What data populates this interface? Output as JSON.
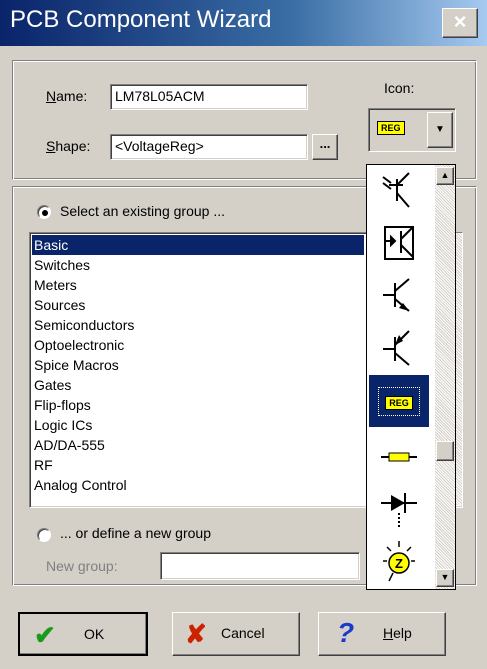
{
  "window": {
    "title": "PCB Component Wizard",
    "close_glyph": "×"
  },
  "form": {
    "name_label": "Name:",
    "name_value": "LM78L05ACM",
    "shape_label": "Shape:",
    "shape_value": "<VoltageReg>",
    "browse_label": "...",
    "icon_label": "Icon:"
  },
  "group": {
    "existing_label": "Select an existing group ...",
    "items": [
      "Basic",
      "Switches",
      "Meters",
      "Sources",
      "Semiconductors",
      "Optoelectronic",
      "Spice Macros",
      "Gates",
      "Flip-flops",
      "Logic ICs",
      "AD/DA-555",
      "RF",
      "Analog Control"
    ],
    "selected": "Basic",
    "new_label": "... or define a new group",
    "new_group_label": "New group:",
    "new_group_value": ""
  },
  "icon_list": {
    "items": [
      "photo-transistor-icon",
      "optocoupler-icon",
      "npn-transistor-icon",
      "pnp-transistor-icon",
      "voltage-regulator-icon",
      "fuse-icon",
      "diode-icon",
      "zener-lamp-icon"
    ],
    "selected_index": 4,
    "reg_text": "REG",
    "z_text": "Z"
  },
  "buttons": {
    "ok": "OK",
    "cancel": "Cancel",
    "help": "Help"
  },
  "colors": {
    "selection": "#0a246a",
    "face": "#d4d0c8",
    "reg_yellow": "#ffff00",
    "ok_green": "#1a9a1a",
    "cancel_red": "#cc2200",
    "help_blue": "#1a3acc"
  }
}
